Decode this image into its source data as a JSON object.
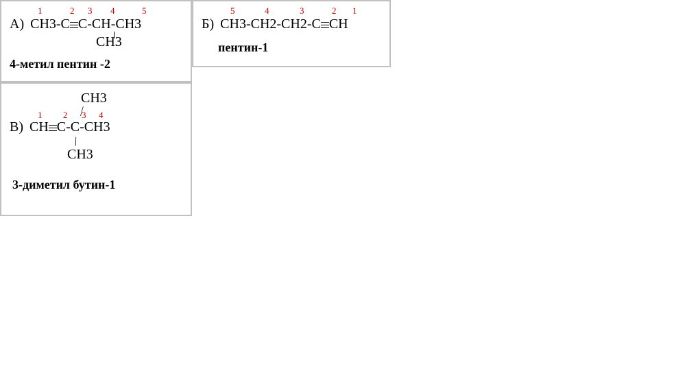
{
  "cells": {
    "a": {
      "label": "А)",
      "formula_main": "CH3-C≡C-CH-CH3",
      "sub_group": "CH3",
      "numbers": [
        "1",
        "2",
        "3",
        "4",
        "5"
      ],
      "name": "4-метил пентин -2"
    },
    "b": {
      "label": "Б)",
      "formula_main": "CH3-CH2-CH2-C≡CH",
      "numbers": [
        "5",
        "4",
        "3",
        "2",
        "1"
      ],
      "name": "пентин-1"
    },
    "c": {
      "label": "В)",
      "formula_main": "CH≡C-C-CH3",
      "top_group": "CH3",
      "bottom_group": "CH3",
      "numbers": [
        "1",
        "2",
        "3",
        "4"
      ],
      "name": "3-диметил бутин-1"
    }
  }
}
